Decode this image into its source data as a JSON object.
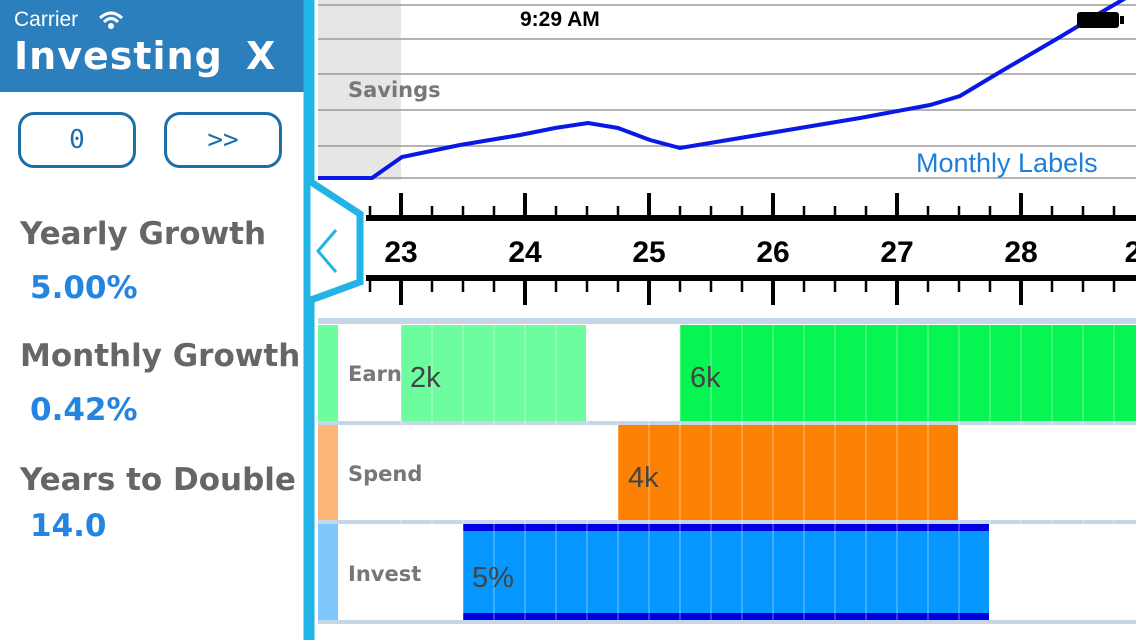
{
  "status_bar": {
    "carrier": "Carrier",
    "time": "9:29 AM"
  },
  "sidebar": {
    "title": "Investing",
    "close": "X",
    "buttons": {
      "reset": "0",
      "forward": ">>"
    },
    "stats": [
      {
        "label": "Yearly Growth",
        "value": "5.00%"
      },
      {
        "label": "Monthly Growth",
        "value": "0.42%"
      },
      {
        "label": "Years to Double",
        "value": "14.0"
      }
    ],
    "collapse_icon": "chevron-left-icon"
  },
  "chart": {
    "savings_label": "Savings",
    "monthly_labels_link": "Monthly Labels",
    "years": [
      "23",
      "24",
      "25",
      "26",
      "27",
      "28",
      "2"
    ],
    "line_color": "#0a18e6"
  },
  "rows": {
    "earn": {
      "label": "Earn",
      "value_1": "2k",
      "value_2": "6k",
      "color_light": "#6dfd9e",
      "color_main": "#07f552"
    },
    "spend": {
      "label": "Spend",
      "value": "4k",
      "color": "#fd8204"
    },
    "invest": {
      "label": "Invest",
      "value": "5%",
      "color": "#0597fd",
      "border_color": "#0000e0"
    }
  }
}
